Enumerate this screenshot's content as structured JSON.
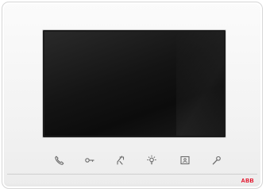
{
  "device": {
    "brand_logo": "ABB",
    "accent_color": "#6b6b6b",
    "logo_color": "#e2001a"
  },
  "screen": {
    "state": "off"
  },
  "buttons": [
    {
      "icon": "phone-handset-icon"
    },
    {
      "icon": "key-icon"
    },
    {
      "icon": "door-open-icon"
    },
    {
      "icon": "light-bulb-icon"
    },
    {
      "icon": "camera-monitor-icon"
    },
    {
      "icon": "settings-wrench-icon"
    }
  ]
}
